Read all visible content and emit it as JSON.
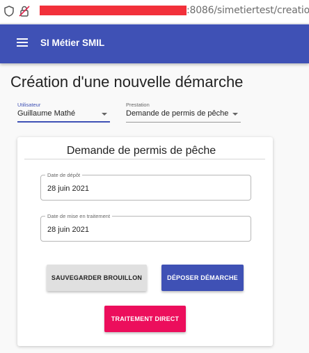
{
  "browser": {
    "url_visible_suffix": ":8086/simetiertest/creation"
  },
  "appbar": {
    "menu_icon": "menu-icon",
    "title": "SI Métier SMIL"
  },
  "page": {
    "title": "Création d'une nouvelle démarche"
  },
  "form": {
    "user": {
      "label": "Utilisateur",
      "value": "Guillaume Mathé"
    },
    "prestation": {
      "label": "Prestation",
      "value": "Demande de permis de pêche"
    }
  },
  "card": {
    "title": "Demande de permis de pêche",
    "date_depot": {
      "label": "Date de dépôt",
      "value": "28 juin 2021"
    },
    "date_traitement": {
      "label": "Date de mise en traitement",
      "value": "28 juin 2021"
    },
    "buttons": {
      "draft": "SAUVEGARDER BROUILLON",
      "submit": "DÉPOSER DÉMARCHE",
      "direct": "TRAITEMENT DIRECT"
    }
  },
  "colors": {
    "primary": "#3f51b5",
    "accent": "#ec0e5c",
    "redaction": "#f2303a"
  }
}
